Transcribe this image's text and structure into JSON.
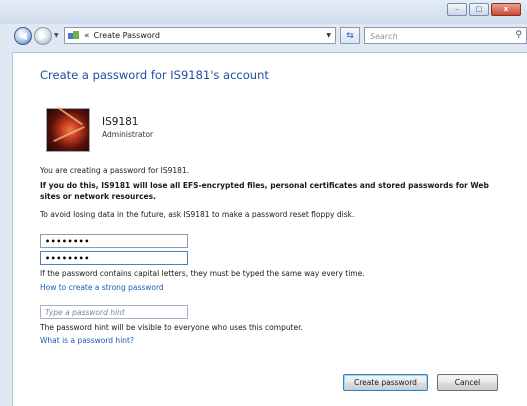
{
  "window": {
    "minimize_glyph": "–",
    "maximize_glyph": "□",
    "close_glyph": "x"
  },
  "navigation": {
    "breadcrumb_separator": "«",
    "breadcrumb": "Create Password",
    "search_placeholder": "Search"
  },
  "icons": [
    "back-icon",
    "forward-icon",
    "control-panel-icon",
    "refresh-icon",
    "search-icon",
    "user-avatar"
  ],
  "page": {
    "heading": "Create a password for IS9181's account",
    "user": {
      "name": "IS9181",
      "role": "Administrator"
    },
    "intro": "You are creating a password for IS9181.",
    "warning_line1": "If you do this, IS9181 will lose all EFS-encrypted files, personal certificates and stored passwords for Web",
    "warning_line2": "sites or network resources.",
    "reset_disk_note": "To avoid losing data in the future, ask IS9181 to make a password reset floppy disk.",
    "new_password_value": "••••••••",
    "confirm_password_value": "••••••••",
    "case_note": "If the password contains capital letters, they must be typed the same way every time.",
    "strong_password_link": "How to create a strong password",
    "hint_placeholder": "Type a password hint",
    "hint_note": "The password hint will be visible to everyone who uses this computer.",
    "hint_link": "What is a password hint?"
  },
  "buttons": {
    "create_password": "Create password",
    "cancel": "Cancel"
  }
}
